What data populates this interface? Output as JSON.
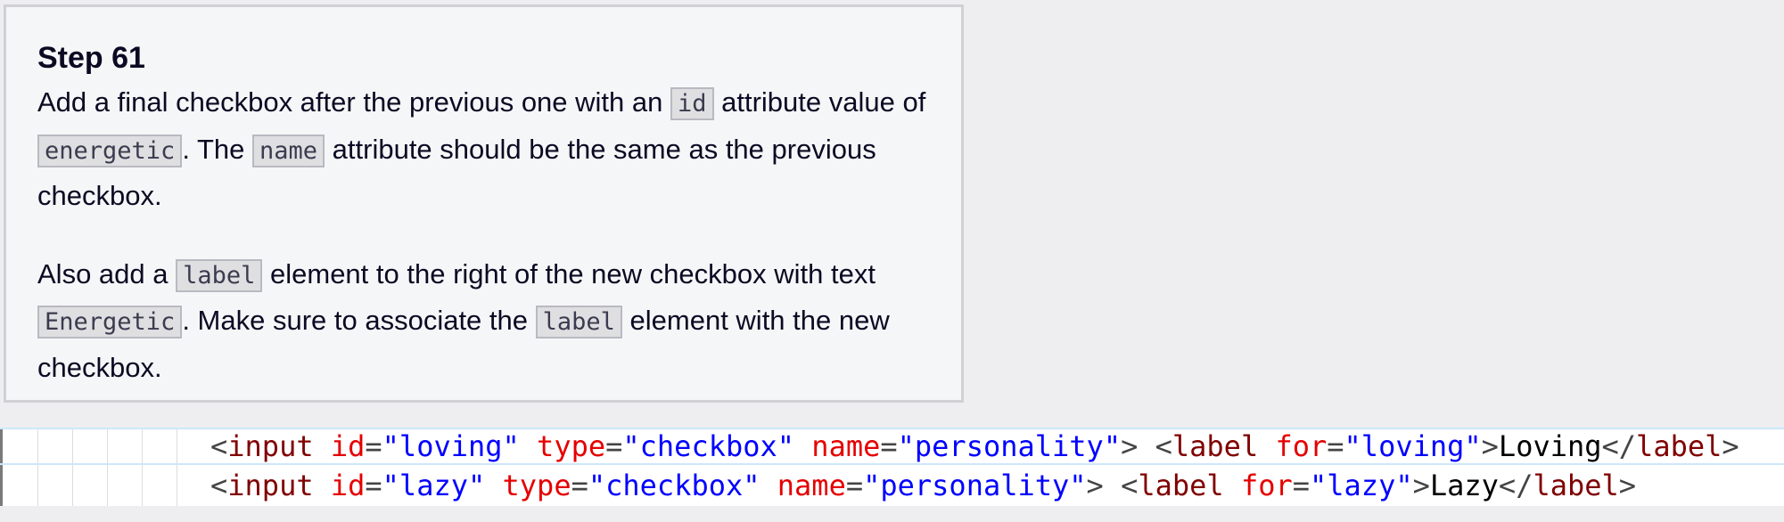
{
  "instructions": {
    "title": "Step 61",
    "para1": {
      "t1": "Add a final checkbox after the previous one with an ",
      "code1": "id",
      "t2": " attribute value of ",
      "code2": "energetic",
      "t3": ". The ",
      "code3": "name",
      "t4": " attribute should be the same as the previous checkbox."
    },
    "para2": {
      "t1": "Also add a ",
      "code1": "label",
      "t2": " element to the right of the new checkbox with text ",
      "code2": "Energetic",
      "t3": ". Make sure to associate the ",
      "code3": "label",
      "t4": " element with the new checkbox."
    }
  },
  "editor": {
    "lines": [
      {
        "open1": "<",
        "tag1": "input",
        "attr1": "id",
        "eq1": "=",
        "val1": "\"loving\"",
        "attr2": "type",
        "eq2": "=",
        "val2": "\"checkbox\"",
        "attr3": "name",
        "eq3": "=",
        "val3": "\"personality\"",
        "close1": ">",
        "open2": "<",
        "tag2": "label",
        "attr4": "for",
        "eq4": "=",
        "val4": "\"loving\"",
        "close2": ">",
        "text": "Loving",
        "endopen": "</",
        "endtag": "label",
        "endclose": ">"
      },
      {
        "open1": "<",
        "tag1": "input",
        "attr1": "id",
        "eq1": "=",
        "val1": "\"lazy\"",
        "attr2": "type",
        "eq2": "=",
        "val2": "\"checkbox\"",
        "attr3": "name",
        "eq3": "=",
        "val3": "\"personality\"",
        "close1": ">",
        "open2": "<",
        "tag2": "label",
        "attr4": "for",
        "eq4": "=",
        "val4": "\"lazy\"",
        "close2": ">",
        "text": "Lazy",
        "endopen": "</",
        "endtag": "label",
        "endclose": ">"
      }
    ]
  },
  "colors": {
    "tag": "#800000",
    "attribute": "#e50000",
    "string": "#0000ff",
    "panel_bg": "#f5f6f7",
    "code_bg": "#dfdfe2"
  }
}
